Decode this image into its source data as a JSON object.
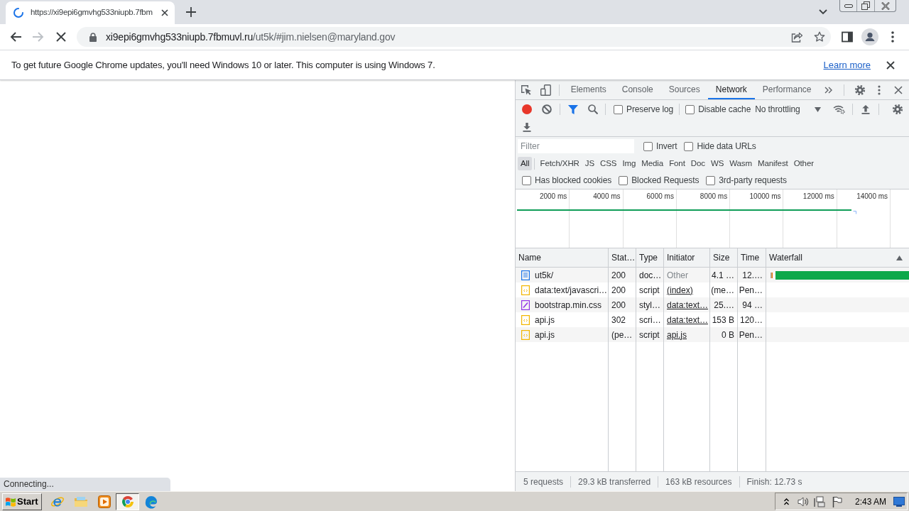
{
  "browser": {
    "tabs": [
      {
        "title": "https://xi9epi6gmvhg533niupb.7fbm",
        "loading": true,
        "selected": true
      }
    ],
    "navigation": {
      "back_disabled": false,
      "forward_disabled": true,
      "loading": true
    },
    "address": {
      "host": "xi9epi6gmvhg533niupb.7fbmuvl.ru",
      "path": "/ut5k/#jim.nielsen@maryland.gov"
    }
  },
  "infobar": {
    "message": "To get future Google Chrome updates, you'll need Windows 10 or later. This computer is using Windows 7.",
    "link": "Learn more"
  },
  "page": {
    "status": "Connecting..."
  },
  "devtools": {
    "panels": [
      {
        "label": "Elements",
        "selected": false
      },
      {
        "label": "Console",
        "selected": false
      },
      {
        "label": "Sources",
        "selected": false
      },
      {
        "label": "Network",
        "selected": true
      },
      {
        "label": "Performance",
        "selected": false
      }
    ],
    "toolbar": {
      "recording": true,
      "options": [
        {
          "label": "Preserve log",
          "checked": false
        },
        {
          "label": "Disable cache",
          "checked": false
        }
      ],
      "throttling": "No throttling"
    },
    "filter": {
      "placeholder": "Filter",
      "options": [
        {
          "label": "Invert",
          "checked": false
        },
        {
          "label": "Hide data URLs",
          "checked": false
        }
      ]
    },
    "types": [
      {
        "label": "All",
        "selected": true
      },
      {
        "label": "Fetch/XHR",
        "selected": false
      },
      {
        "label": "JS",
        "selected": false
      },
      {
        "label": "CSS",
        "selected": false
      },
      {
        "label": "Img",
        "selected": false
      },
      {
        "label": "Media",
        "selected": false
      },
      {
        "label": "Font",
        "selected": false
      },
      {
        "label": "Doc",
        "selected": false
      },
      {
        "label": "WS",
        "selected": false
      },
      {
        "label": "Wasm",
        "selected": false
      },
      {
        "label": "Manifest",
        "selected": false
      },
      {
        "label": "Other",
        "selected": false
      }
    ],
    "request_options": [
      {
        "label": "Has blocked cookies",
        "checked": false
      },
      {
        "label": "Blocked Requests",
        "checked": false
      },
      {
        "label": "3rd-party requests",
        "checked": false
      }
    ],
    "overview": {
      "ticks": [
        "2000 ms",
        "4000 ms",
        "6000 ms",
        "8000 ms",
        "10000 ms",
        "12000 ms",
        "14000 ms"
      ]
    },
    "table": {
      "columns": [
        {
          "label": "Name",
          "sorted": false
        },
        {
          "label": "Stat…",
          "sorted": false
        },
        {
          "label": "Type",
          "sorted": false
        },
        {
          "label": "Initiator",
          "sorted": false
        },
        {
          "label": "Size",
          "sorted": false
        },
        {
          "label": "Time",
          "sorted": false
        },
        {
          "label": "Waterfall",
          "sorted": true
        }
      ],
      "rows": [
        {
          "kind": "document",
          "name": "ut5k/",
          "status": "200",
          "type": "doc…",
          "initiator": "Other",
          "initiator_link": false,
          "size": "4.1 …",
          "time": "12.…",
          "waterfall_bar": true
        },
        {
          "kind": "script",
          "name": "data:text/javascri…",
          "status": "200",
          "type": "script",
          "initiator": "(index)",
          "initiator_link": true,
          "size": "(me…",
          "time": "Pen…",
          "waterfall_bar": false
        },
        {
          "kind": "stylesheet",
          "name": "bootstrap.min.css",
          "status": "200",
          "type": "styl…",
          "initiator": "data:text…",
          "initiator_link": true,
          "size": "25.…",
          "time": "94 …",
          "waterfall_bar": false
        },
        {
          "kind": "script",
          "name": "api.js",
          "status": "302",
          "type": "scri…",
          "initiator": "data:text…",
          "initiator_link": true,
          "size": "153 B",
          "time": "120…",
          "waterfall_bar": false
        },
        {
          "kind": "script",
          "name": "api.js",
          "status": "(pe…",
          "type": "script",
          "initiator": "api.js",
          "initiator_link": true,
          "size": "0 B",
          "time": "Pen…",
          "waterfall_bar": false
        }
      ]
    },
    "summary": [
      "5 requests",
      "29.3 kB transferred",
      "163 kB resources",
      "Finish: 12.73 s"
    ]
  },
  "taskbar": {
    "start": "Start",
    "apps": [
      {
        "kind": "ie",
        "selected": false
      },
      {
        "kind": "explorer",
        "selected": false
      },
      {
        "kind": "media_player",
        "selected": false
      },
      {
        "kind": "chrome",
        "selected": true
      },
      {
        "kind": "edge",
        "selected": false
      }
    ],
    "clock": "2:43 AM"
  }
}
